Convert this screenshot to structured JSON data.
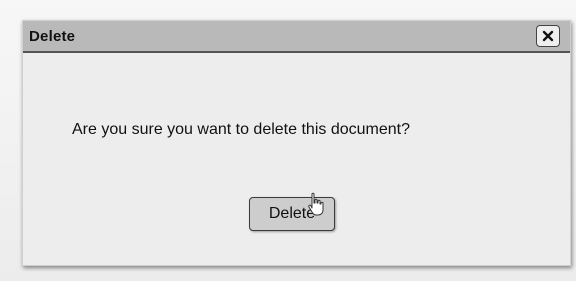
{
  "dialog": {
    "title": "Delete",
    "close_icon": "close-icon",
    "message": "Are you sure you want to delete this document?",
    "delete_label": "Delete"
  },
  "cursor": {
    "icon": "hand-pointer-icon"
  },
  "colors": {
    "titlebar": "#b9b9b9",
    "dialog_bg": "#ededed",
    "button_bg": "#cdcdcd",
    "border": "#3a3a3a"
  }
}
